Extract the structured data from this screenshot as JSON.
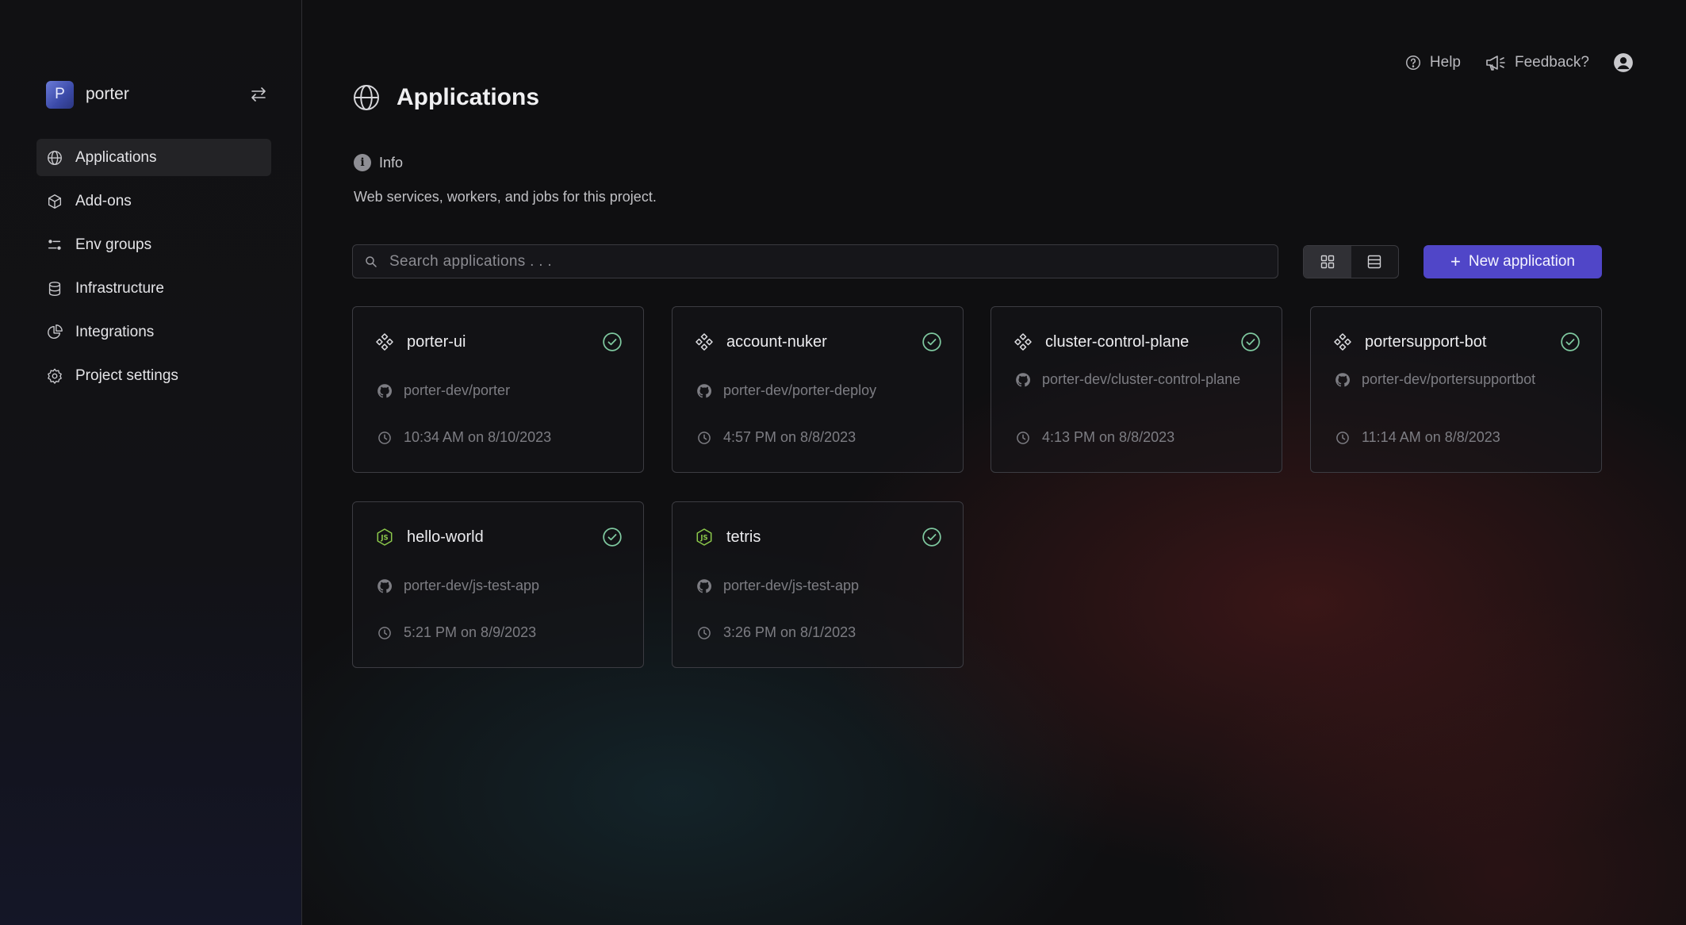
{
  "project": {
    "initial": "P",
    "name": "porter"
  },
  "sidebar": {
    "items": [
      {
        "label": "Applications",
        "icon": "globe-icon",
        "active": true
      },
      {
        "label": "Add-ons",
        "icon": "cube-icon"
      },
      {
        "label": "Env groups",
        "icon": "sliders-icon"
      },
      {
        "label": "Infrastructure",
        "icon": "database-icon"
      },
      {
        "label": "Integrations",
        "icon": "pie-chart-icon"
      },
      {
        "label": "Project settings",
        "icon": "gear-icon"
      }
    ]
  },
  "topbar": {
    "help": "Help",
    "feedback": "Feedback?"
  },
  "page": {
    "title": "Applications",
    "info_label": "Info",
    "description": "Web services, workers, and jobs for this project."
  },
  "search": {
    "placeholder": "Search applications . . ."
  },
  "toolbar": {
    "new_app_label": "New application",
    "view_mode": "grid"
  },
  "apps": [
    {
      "name": "porter-ui",
      "icon": "helm-icon",
      "repo": "porter-dev/porter",
      "time": "10:34 AM on 8/10/2023",
      "status": "healthy"
    },
    {
      "name": "account-nuker",
      "icon": "helm-icon",
      "repo": "porter-dev/porter-deploy",
      "time": "4:57 PM on 8/8/2023",
      "status": "healthy"
    },
    {
      "name": "cluster-control-plane",
      "icon": "helm-icon",
      "repo": "porter-dev/cluster-control-plane",
      "time": "4:13 PM on 8/8/2023",
      "status": "healthy"
    },
    {
      "name": "portersupport-bot",
      "icon": "helm-icon",
      "repo": "porter-dev/portersupportbot",
      "time": "11:14 AM on 8/8/2023",
      "status": "healthy"
    },
    {
      "name": "hello-world",
      "icon": "nodejs-icon",
      "repo": "porter-dev/js-test-app",
      "time": "5:21 PM on 8/9/2023",
      "status": "healthy"
    },
    {
      "name": "tetris",
      "icon": "nodejs-icon",
      "repo": "porter-dev/js-test-app",
      "time": "3:26 PM on 8/1/2023",
      "status": "healthy"
    }
  ],
  "colors": {
    "accent": "#5046c8",
    "status_ok": "#7fc9a0",
    "nodejs": "#8cc84b"
  }
}
